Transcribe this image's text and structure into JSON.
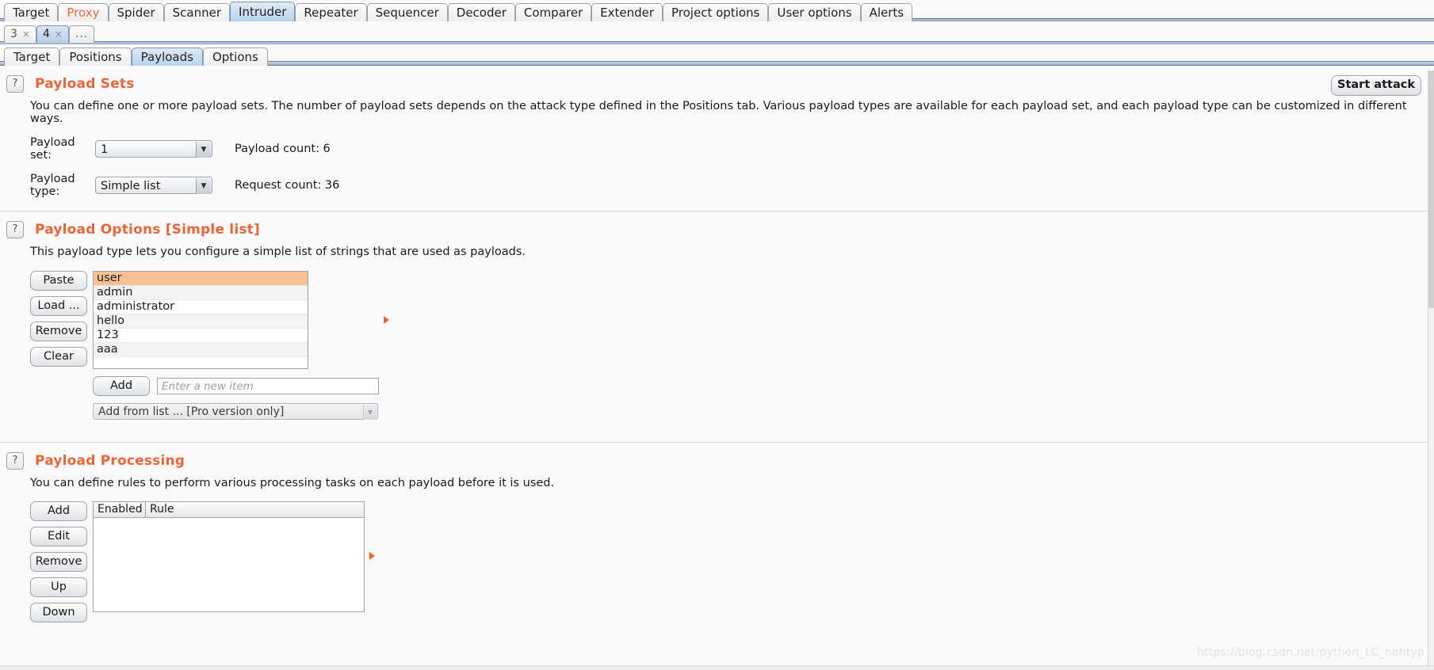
{
  "main_tabs": [
    {
      "label": "Target",
      "selected": false,
      "accent": false
    },
    {
      "label": "Proxy",
      "selected": false,
      "accent": true
    },
    {
      "label": "Spider",
      "selected": false,
      "accent": false
    },
    {
      "label": "Scanner",
      "selected": false,
      "accent": false
    },
    {
      "label": "Intruder",
      "selected": true,
      "accent": false
    },
    {
      "label": "Repeater",
      "selected": false,
      "accent": false
    },
    {
      "label": "Sequencer",
      "selected": false,
      "accent": false
    },
    {
      "label": "Decoder",
      "selected": false,
      "accent": false
    },
    {
      "label": "Comparer",
      "selected": false,
      "accent": false
    },
    {
      "label": "Extender",
      "selected": false,
      "accent": false
    },
    {
      "label": "Project options",
      "selected": false,
      "accent": false
    },
    {
      "label": "User options",
      "selected": false,
      "accent": false
    },
    {
      "label": "Alerts",
      "selected": false,
      "accent": false
    }
  ],
  "attack_tabs": [
    {
      "label": "3",
      "close": "×",
      "selected": false
    },
    {
      "label": "4",
      "close": "×",
      "selected": true
    }
  ],
  "attack_tabs_more": "...",
  "sub_tabs": [
    {
      "label": "Target",
      "selected": false
    },
    {
      "label": "Positions",
      "selected": false
    },
    {
      "label": "Payloads",
      "selected": true
    },
    {
      "label": "Options",
      "selected": false
    }
  ],
  "start_attack_label": "Start attack",
  "help_glyph": "?",
  "payload_sets": {
    "title": "Payload Sets",
    "description": "You can define one or more payload sets. The number of payload sets depends on the attack type defined in the Positions tab. Various payload types are available for each payload set, and each payload type can be customized in different ways.",
    "payload_set_label": "Payload set:",
    "payload_set_value": "1",
    "payload_type_label": "Payload type:",
    "payload_type_value": "Simple list",
    "payload_count_label": "Payload count:  6",
    "request_count_label": "Request count:  36"
  },
  "payload_options": {
    "title": "Payload Options [Simple list]",
    "description": "This payload type lets you configure a simple list of strings that are used as payloads.",
    "buttons": [
      {
        "label": "Paste"
      },
      {
        "label": "Load ..."
      },
      {
        "label": "Remove"
      },
      {
        "label": "Clear"
      }
    ],
    "items": [
      "user",
      "admin",
      "administrator",
      "hello",
      "123",
      "aaa"
    ],
    "selected_index": 0,
    "add_button": "Add",
    "add_placeholder": "Enter a new item",
    "add_from_list": "Add from list ... [Pro version only]"
  },
  "payload_processing": {
    "title": "Payload Processing",
    "description": "You can define rules to perform various processing tasks on each payload before it is used.",
    "buttons": [
      {
        "label": "Add"
      },
      {
        "label": "Edit"
      },
      {
        "label": "Remove"
      },
      {
        "label": "Up"
      },
      {
        "label": "Down"
      }
    ],
    "columns": [
      "Enabled",
      "Rule"
    ],
    "rows": []
  },
  "watermark": "https://blog.csdn.net/python_LC_nohtyp",
  "colors": {
    "accent_orange": "#e8663a",
    "selection_orange": "#f9c193",
    "tab_selected_blue": "#bad3ec"
  }
}
